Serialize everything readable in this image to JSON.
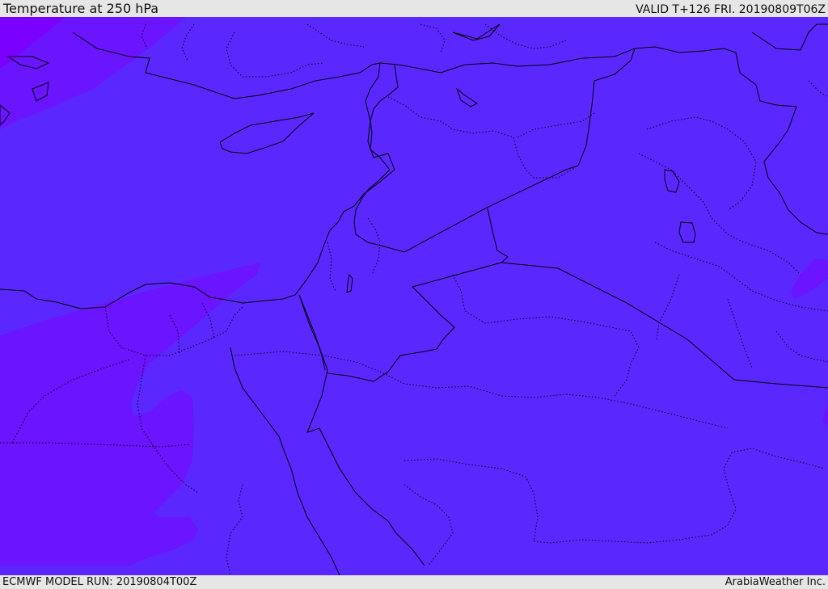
{
  "header": {
    "title": "Temperature at 250 hPa",
    "valid": "VALID T+126 FRI. 20190809T06Z"
  },
  "footer": {
    "model_run": "ECMWF MODEL RUN: 20190804T00Z",
    "credit": "ArabiaWeather Inc."
  },
  "map": {
    "fill_colors": {
      "main": "#5a28ff",
      "cooler": "#6a14ff",
      "coldest": "#7a00ff"
    },
    "border_color": "#000000"
  }
}
